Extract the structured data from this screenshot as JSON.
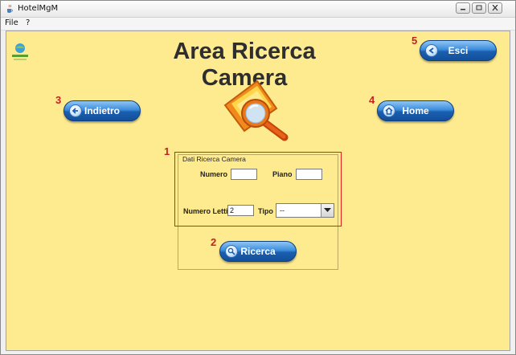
{
  "window": {
    "title": "HotelMgM",
    "icon": "java-cup-icon"
  },
  "menubar": {
    "file": "File",
    "help": "?"
  },
  "page": {
    "title": "Area Ricerca Camera",
    "logo_icon": "hotel-logo-icon",
    "main_icon": "magnifier-icon"
  },
  "buttons": {
    "esci": {
      "label": "Esci",
      "icon": "logout-icon",
      "number": "5"
    },
    "indietro": {
      "label": "Indietro",
      "icon": "back-arrow-icon",
      "number": "3"
    },
    "home": {
      "label": "Home",
      "icon": "home-icon",
      "number": "4"
    },
    "ricerca": {
      "label": "Ricerca",
      "icon": "search-icon",
      "number": "2"
    }
  },
  "search_panel": {
    "number": "1",
    "legend": "Dati Ricerca Camera",
    "numero": {
      "label": "Numero",
      "value": ""
    },
    "piano": {
      "label": "Piano",
      "value": ""
    },
    "numero_letti": {
      "label": "Numero Letti",
      "value": "2"
    },
    "tipo": {
      "label": "Tipo",
      "selected": "--"
    }
  },
  "colors": {
    "background": "#feeb90",
    "button_blue": "#1a5fb0",
    "annotation_red": "#c5221f"
  }
}
